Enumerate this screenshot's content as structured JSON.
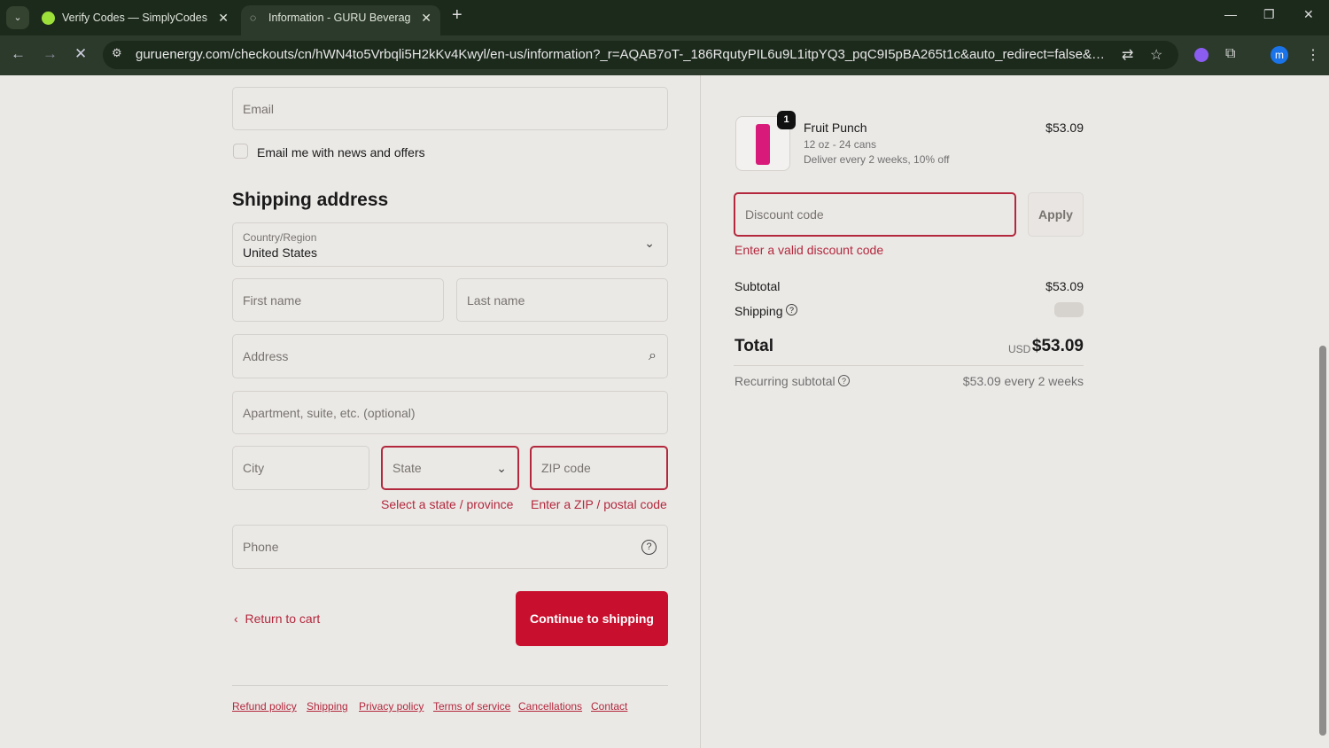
{
  "browser": {
    "tabs": [
      {
        "title": "Verify Codes — SimplyCodes"
      },
      {
        "title": "Information - GURU Beverage"
      }
    ],
    "url": "guruenergy.com/checkouts/cn/hWN4to5Vrbqli5H2kKv4Kwyl/en-us/information?_r=AQAB7oT-_186RqutyPIL6u9L1itpYQ3_pqC9I5pBA265t1c&auto_redirect=false&edge_redirect=tru...",
    "profile": "m"
  },
  "form": {
    "email_placeholder": "Email",
    "newsletter_label": "Email me with news and offers",
    "shipping_heading": "Shipping address",
    "country_label": "Country/Region",
    "country_value": "United States",
    "first_name": "First name",
    "last_name": "Last name",
    "address": "Address",
    "apartment": "Apartment, suite, etc. (optional)",
    "city": "City",
    "state": "State",
    "zip": "ZIP code",
    "state_error": "Select a state / province",
    "zip_error": "Enter a ZIP / postal code",
    "phone": "Phone",
    "return_label": "Return to cart",
    "continue_label": "Continue to shipping"
  },
  "footer_links": [
    "Refund policy",
    "Shipping",
    "Privacy policy",
    "Terms of service",
    "Cancellations",
    "Contact"
  ],
  "summary": {
    "item": {
      "name": "Fruit Punch",
      "variant": "12 oz - 24 cans",
      "plan": "Deliver every 2 weeks, 10% off",
      "price": "$53.09",
      "qty": "1"
    },
    "discount_placeholder": "Discount code",
    "apply": "Apply",
    "discount_error": "Enter a valid discount code",
    "subtotal_label": "Subtotal",
    "subtotal": "$53.09",
    "shipping_label": "Shipping",
    "total_label": "Total",
    "currency": "USD",
    "total": "$53.09",
    "recurring_label": "Recurring subtotal",
    "recurring": "$53.09 every 2 weeks"
  },
  "colors": {
    "accent": "#c8102e",
    "error": "#b3283d"
  }
}
